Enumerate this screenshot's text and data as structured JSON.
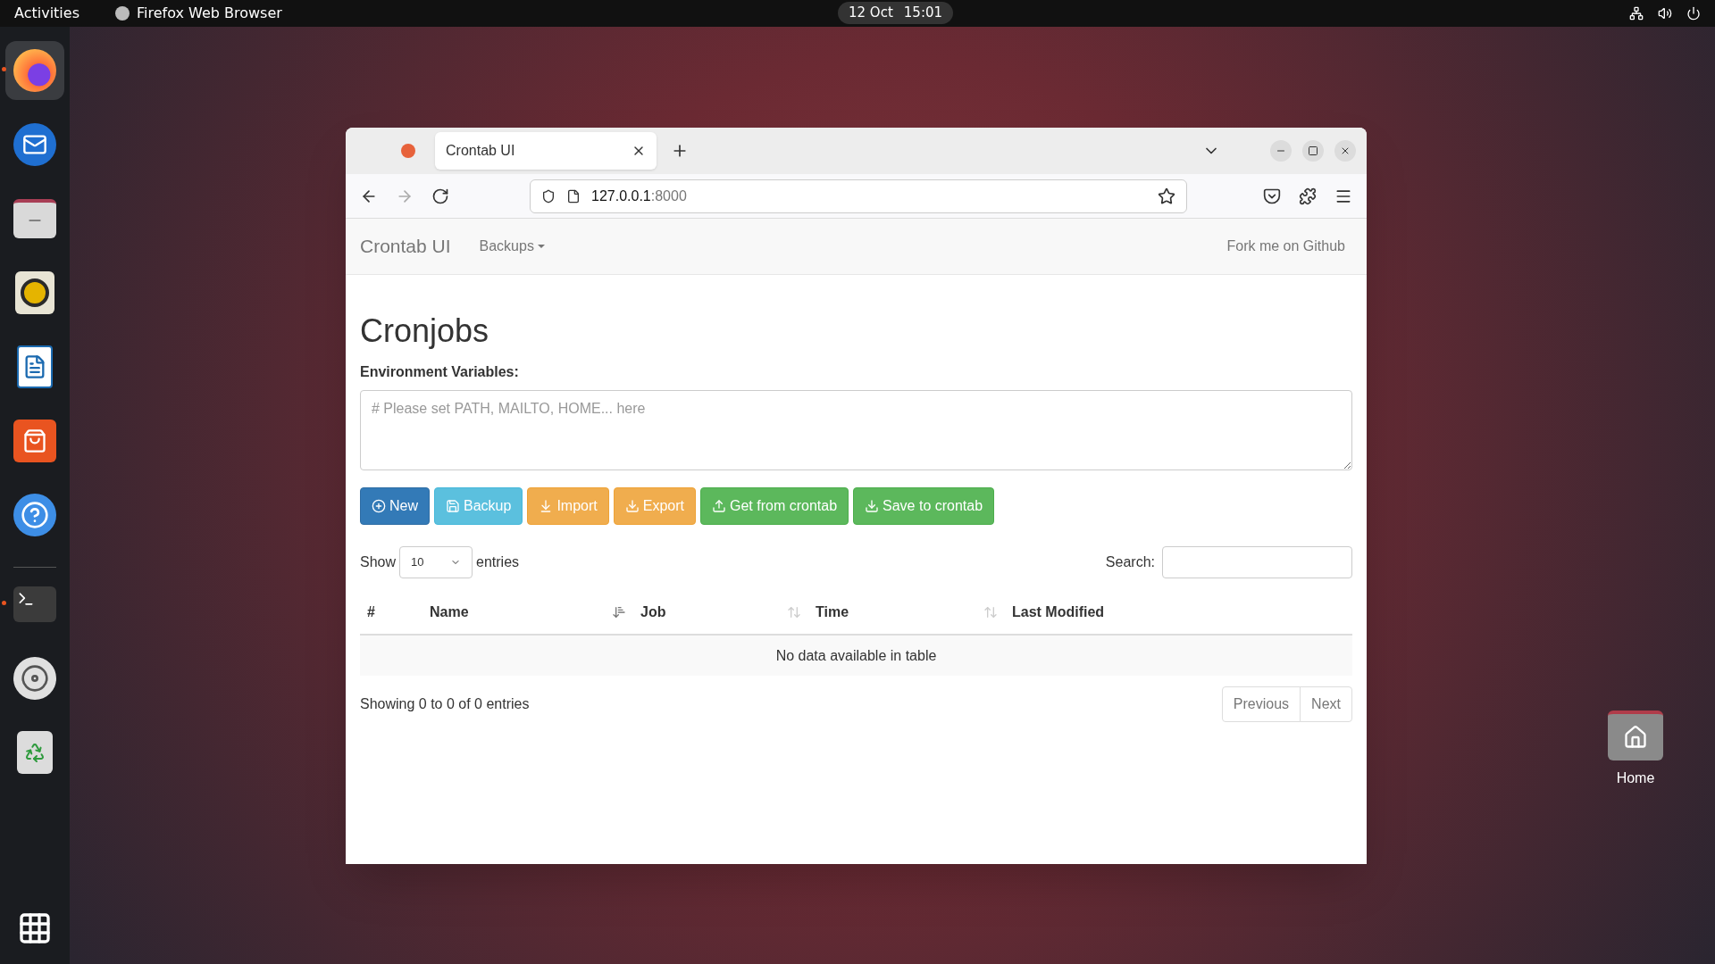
{
  "top_bar": {
    "activities": "Activities",
    "app_name": "Firefox Web Browser",
    "date": "12 Oct",
    "time": "15:01"
  },
  "dock": [
    {
      "kind": "firefox",
      "running": true,
      "selected": true
    },
    {
      "kind": "mail",
      "running": false,
      "selected": false
    },
    {
      "kind": "files",
      "running": false,
      "selected": false
    },
    {
      "kind": "music",
      "running": false,
      "selected": false
    },
    {
      "kind": "writer",
      "running": false,
      "selected": false
    },
    {
      "kind": "store",
      "running": false,
      "selected": false
    },
    {
      "kind": "help",
      "running": false,
      "selected": false
    },
    {
      "kind": "terminal",
      "running": true,
      "selected": false
    },
    {
      "kind": "disc",
      "running": false,
      "selected": false
    },
    {
      "kind": "trash",
      "running": false,
      "selected": false
    }
  ],
  "desktop_icons": [
    {
      "label": "Home"
    }
  ],
  "browser": {
    "tab_title": "Crontab UI",
    "url_host": "127.0.0.1",
    "url_rest": ":8000"
  },
  "navbar": {
    "brand": "Crontab UI",
    "menu": "Backups",
    "link": "Fork me on Github"
  },
  "page": {
    "heading": "Cronjobs",
    "env_label": "Environment Variables:",
    "env_placeholder": "# Please set PATH, MAILTO, HOME... here",
    "buttons": [
      {
        "label": "New",
        "kind": "primary"
      },
      {
        "label": "Backup",
        "kind": "info"
      },
      {
        "label": "Import",
        "kind": "warning"
      },
      {
        "label": "Export",
        "kind": "warning"
      },
      {
        "label": "Get from crontab",
        "kind": "success"
      },
      {
        "label": "Save to crontab",
        "kind": "success"
      }
    ],
    "show_label": "Show",
    "page_size": "10",
    "entries_label": "entries",
    "search_label": "Search:",
    "columns": [
      {
        "label": "#",
        "sortable": false,
        "sorted": false
      },
      {
        "label": "Name",
        "sortable": true,
        "sorted": true
      },
      {
        "label": "Job",
        "sortable": true,
        "sorted": false
      },
      {
        "label": "Time",
        "sortable": true,
        "sorted": false
      },
      {
        "label": "Last Modified",
        "sortable": false,
        "sorted": false
      }
    ],
    "empty_message": "No data available in table",
    "info": "Showing 0 to 0 of 0 entries",
    "pagination": [
      {
        "label": "Previous",
        "disabled": true
      },
      {
        "label": "Next",
        "disabled": true
      }
    ]
  }
}
